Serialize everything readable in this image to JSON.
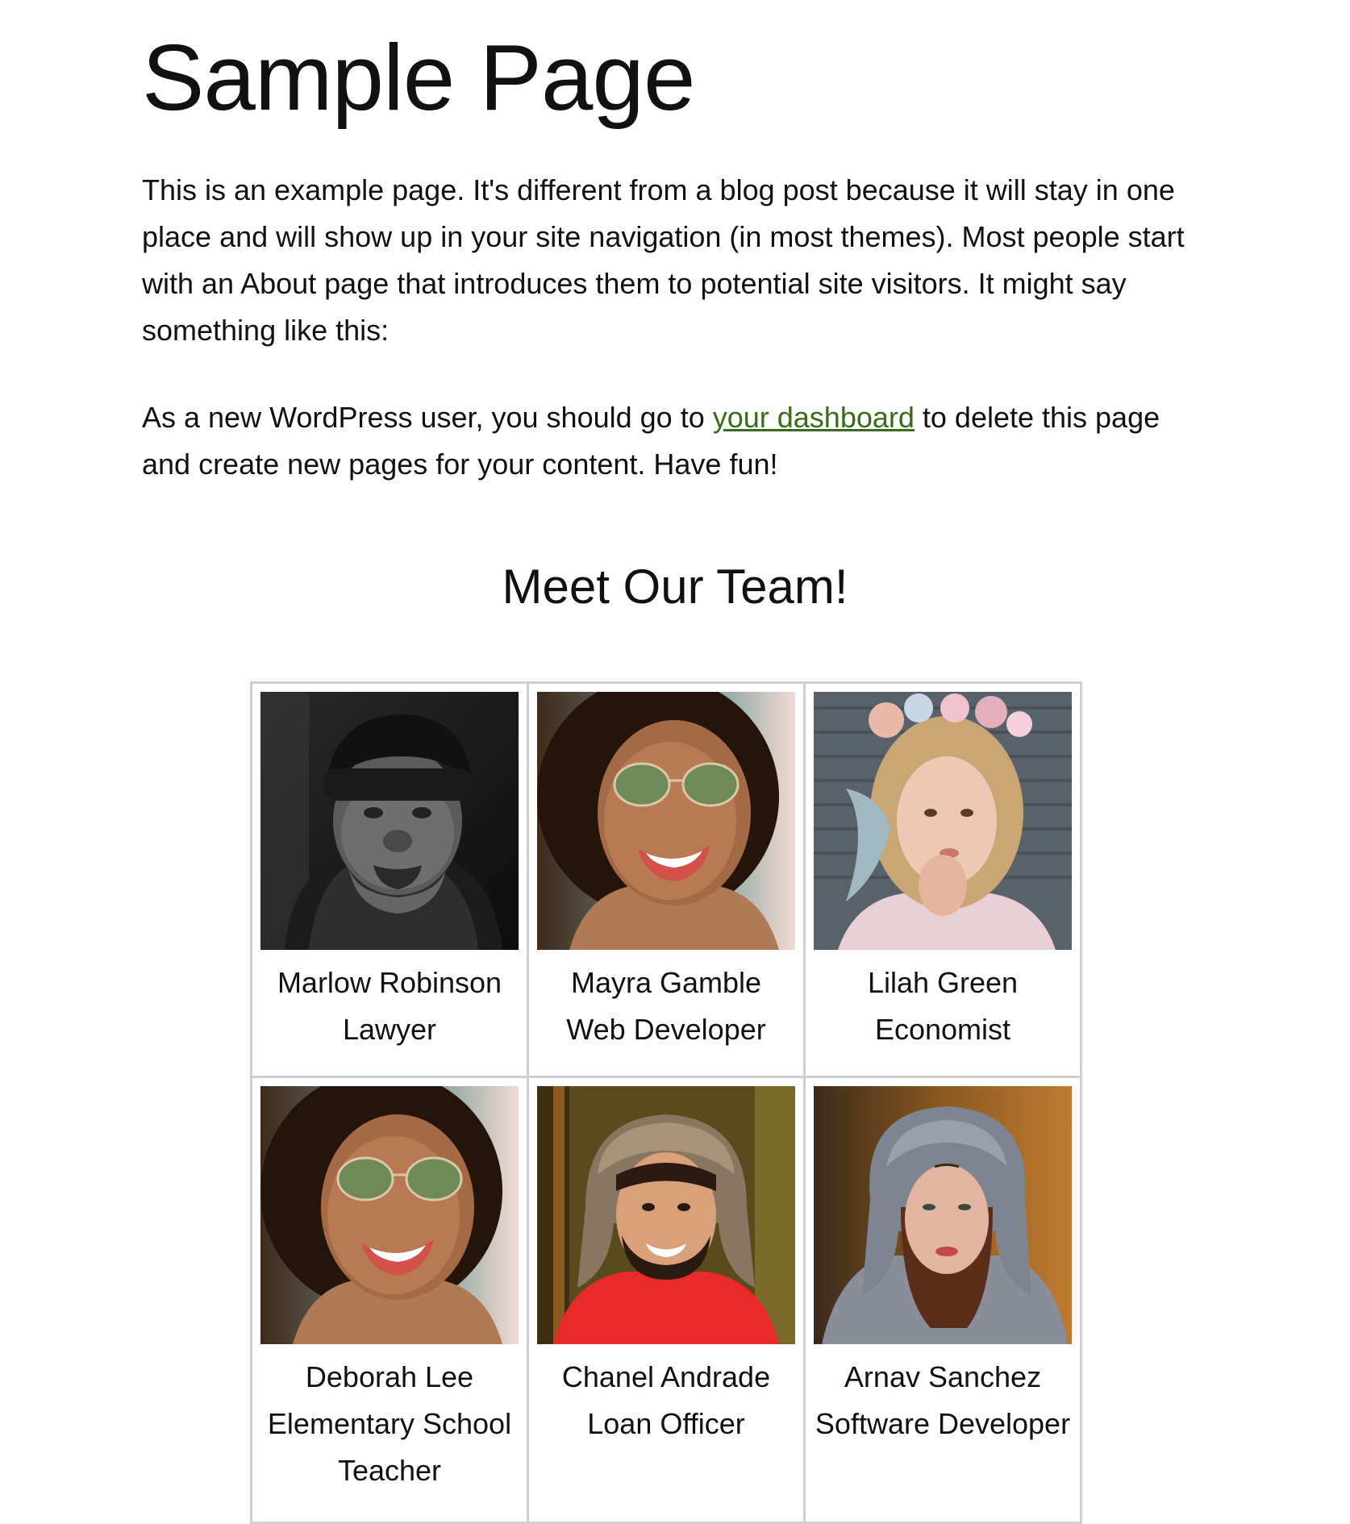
{
  "page": {
    "title": "Sample Page",
    "paragraph1": "This is an example page. It's different from a blog post because it will stay in one place and will show up in your site navigation (in most themes). Most people start with an About page that introduces them to potential site visitors. It might say something like this:",
    "paragraph2_before": "As a new WordPress user, you should go to ",
    "paragraph2_link": "your dashboard",
    "paragraph2_after": " to delete this page and create new pages for your content. Have fun!",
    "link_color": "#3a6a1c"
  },
  "team": {
    "heading": "Meet Our Team!",
    "members": [
      {
        "name": "Marlow Robinson",
        "role": "Lawyer"
      },
      {
        "name": "Mayra Gamble",
        "role": "Web Developer"
      },
      {
        "name": "Lilah Green",
        "role": "Economist"
      },
      {
        "name": "Deborah Lee",
        "role": "Elementary School Teacher"
      },
      {
        "name": "Chanel Andrade",
        "role": "Loan Officer"
      },
      {
        "name": "Arnav Sanchez",
        "role": "Software Developer"
      }
    ]
  }
}
